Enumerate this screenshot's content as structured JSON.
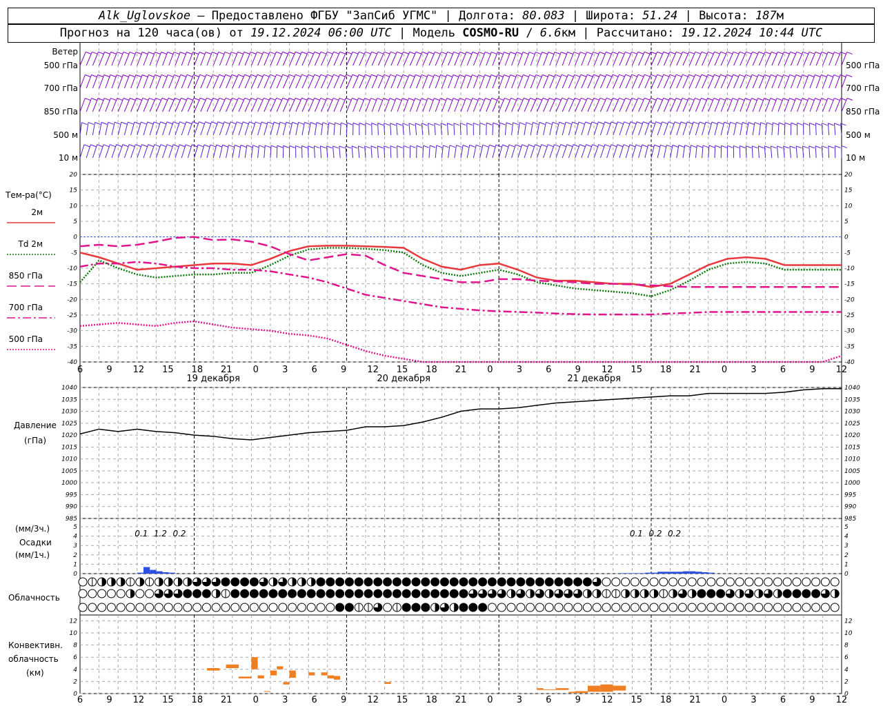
{
  "header": {
    "station": "Alk_Uglovskoe",
    "provider": "Предоставлено ФГБУ \"ЗапСиб УГМС\"",
    "lon_label": "Долгота:",
    "lon_value": "80.083",
    "lat_label": "Широта:",
    "lat_value": "51.24",
    "alt_label": "Высота:",
    "alt_value": "187",
    "alt_unit": "м",
    "forecast_prefix": "Прогноз на 120 часа(ов) от",
    "forecast_time": "19.12.2024 06:00 UTC",
    "model_label": "Модель",
    "model_name": "COSMO-RU",
    "model_res": "6.6",
    "model_res_unit": "км",
    "calc_label": "Рассчитано:",
    "calc_time": "19.12.2024 10:44 UTC"
  },
  "x_hour_labels": [
    "6",
    "9",
    "12",
    "15",
    "18",
    "21",
    "0",
    "3",
    "6",
    "9",
    "12",
    "15",
    "18",
    "21",
    "0",
    "3",
    "6",
    "9",
    "12",
    "15",
    "18",
    "21",
    "0",
    "3",
    "6",
    "9",
    "12"
  ],
  "day_labels": [
    "19 декабря",
    "20 декабря",
    "21 декабря"
  ],
  "wind_panel": {
    "title": "Ветер",
    "levels": [
      "500 гПа",
      "700 гПа",
      "850 гПа",
      "500 м",
      "10 м"
    ],
    "colors": {
      "upper": "#8000c0",
      "lower": "#5a1ed0"
    }
  },
  "temp_panel": {
    "title": "Тем-ра(°C)",
    "legend": [
      {
        "label": "2м",
        "color": "#e8383c",
        "style": "solid"
      },
      {
        "label": "Td  2м",
        "color": "#0a7a0a",
        "style": "dotted"
      },
      {
        "label": "850 гПа",
        "color": "#e0148c",
        "style": "dashed"
      },
      {
        "label": "700 гПа",
        "color": "#e0148c",
        "style": "dashdot"
      },
      {
        "label": "500 гПа",
        "color": "#e0148c",
        "style": "dotted"
      }
    ],
    "y_ticks": [
      "20",
      "15",
      "10",
      "5",
      "0",
      "-5",
      "-10",
      "-15",
      "-20",
      "-25",
      "-30",
      "-35",
      "-40"
    ]
  },
  "pressure_panel": {
    "title": "Давление",
    "unit": "(гПа)",
    "y_ticks": [
      "1040",
      "1035",
      "1030",
      "1025",
      "1020",
      "1015",
      "1010",
      "1005",
      "1000",
      "995",
      "990",
      "985"
    ]
  },
  "precip_panel": {
    "unit_3h": "(мм/3ч.)",
    "title": "Осадки",
    "unit_1h": "(мм/1ч.)",
    "y_ticks": [
      "5",
      "4",
      "3",
      "2",
      "1",
      "0"
    ],
    "totals": [
      {
        "value": "0.1",
        "at_hour": 9
      },
      {
        "value": "1.2",
        "at_hour": 12
      },
      {
        "value": "0.2",
        "at_hour": 15
      },
      {
        "value": "0.1",
        "at_hour": 87
      },
      {
        "value": "0.2",
        "at_hour": 90
      },
      {
        "value": "0.2",
        "at_hour": 93
      }
    ]
  },
  "cloud_panel": {
    "title": "Облачность"
  },
  "conv_panel": {
    "title_1": "Конвективн.",
    "title_2": "облачность",
    "unit": "(км)",
    "y_ticks": [
      "12",
      "10",
      "8",
      "6",
      "4",
      "2",
      "0"
    ]
  },
  "chart_data": [
    {
      "type": "line",
      "title": "Тем-ра(°C)",
      "x_unit": "hours since 19.12.2024 06:00 UTC",
      "x": [
        0,
        3,
        6,
        9,
        12,
        15,
        18,
        21,
        24,
        27,
        30,
        33,
        36,
        39,
        42,
        45,
        48,
        51,
        54,
        57,
        60,
        63,
        66,
        69,
        72,
        75,
        78,
        81,
        84,
        87,
        90,
        93,
        96,
        99,
        102,
        105,
        108,
        111,
        114,
        117,
        120
      ],
      "ylim": [
        -40,
        20
      ],
      "series": [
        {
          "name": "2м",
          "values": [
            -5,
            -6.5,
            -8.5,
            -10.5,
            -10,
            -9.5,
            -9,
            -8.5,
            -8.5,
            -9,
            -7,
            -4.5,
            -3,
            -2.8,
            -2.8,
            -3,
            -3.2,
            -3.5,
            -7,
            -9.5,
            -10.5,
            -9,
            -8.5,
            -10.5,
            -13,
            -14,
            -14,
            -14.5,
            -15,
            -15,
            -16,
            -15,
            -12,
            -9,
            -7,
            -6.5,
            -7,
            -9,
            -9,
            -9,
            -9
          ]
        },
        {
          "name": "Td  2м",
          "values": [
            -14.5,
            -7.5,
            -10,
            -12,
            -13,
            -12.5,
            -12,
            -12,
            -11.5,
            -11.5,
            -9,
            -6,
            -4,
            -3.5,
            -3.5,
            -3.8,
            -4.2,
            -5,
            -9,
            -11.5,
            -12.5,
            -11.5,
            -10.5,
            -12,
            -14.5,
            -15.5,
            -16.5,
            -17,
            -17.5,
            -18,
            -19,
            -17,
            -14,
            -10.5,
            -8.5,
            -8,
            -8.5,
            -10.5,
            -10.5,
            -10.5,
            -10.5
          ]
        },
        {
          "name": "850 гПа",
          "values": [
            -3,
            -2.5,
            -3,
            -2.5,
            -1.5,
            -0.3,
            0,
            -1,
            -0.8,
            -1.5,
            -3,
            -5.5,
            -7.5,
            -6.5,
            -5.5,
            -6,
            -9,
            -11.5,
            -12.5,
            -13.5,
            -14.5,
            -14.5,
            -13.5,
            -13.5,
            -14,
            -14.2,
            -14.5,
            -15,
            -15,
            -15.2,
            -15.5,
            -15.8,
            -16,
            -16,
            -16,
            -16,
            -16,
            -16,
            -16,
            -16,
            -16
          ]
        },
        {
          "name": "700 гПа",
          "values": [
            -9.5,
            -8.5,
            -8.5,
            -8,
            -8.5,
            -9.5,
            -10,
            -10,
            -10.5,
            -10.5,
            -11,
            -12,
            -13,
            -14.5,
            -16.5,
            -18.5,
            -19.5,
            -20.5,
            -21.5,
            -22.5,
            -23,
            -23.5,
            -23.8,
            -24,
            -24.2,
            -24.5,
            -24.7,
            -24.8,
            -24.8,
            -24.8,
            -24.8,
            -24.5,
            -24.3,
            -24,
            -24,
            -24,
            -24,
            -24,
            -24,
            -24,
            -24
          ]
        },
        {
          "name": "500 гПа",
          "values": [
            -28.5,
            -28,
            -27.5,
            -28,
            -28.5,
            -27.5,
            -27,
            -28,
            -29,
            -29.5,
            -30,
            -31,
            -31.5,
            -32.5,
            -34.5,
            -36.5,
            -38,
            -39,
            -40,
            -41,
            -42,
            -42,
            -42,
            -42,
            -42,
            -42,
            -42,
            -42,
            -42,
            -42,
            -42,
            -42,
            -42,
            -42,
            -42,
            -42,
            -42,
            -42,
            -42,
            -42,
            -38
          ]
        }
      ]
    },
    {
      "type": "line",
      "title": "Давление",
      "x": [
        0,
        3,
        6,
        9,
        12,
        15,
        18,
        21,
        24,
        27,
        30,
        33,
        36,
        39,
        42,
        45,
        48,
        51,
        54,
        57,
        60,
        63,
        66,
        69,
        72,
        75,
        78,
        81,
        84,
        87,
        90,
        93,
        96,
        99,
        102,
        105,
        108,
        111,
        114,
        117,
        120
      ],
      "ylim": [
        985,
        1040
      ],
      "series": [
        {
          "name": "",
          "values": [
            1020.5,
            1022.5,
            1021.5,
            1022.5,
            1021.5,
            1021,
            1020,
            1019.5,
            1018.5,
            1018,
            1019,
            1020,
            1021,
            1021.5,
            1022,
            1023.5,
            1023.5,
            1024,
            1025.5,
            1027.5,
            1030,
            1031,
            1031,
            1031.5,
            1032.5,
            1033.5,
            1034,
            1034.5,
            1035,
            1035.5,
            1036,
            1036.5,
            1036.5,
            1037.5,
            1037.5,
            1037.5,
            1037.5,
            1038,
            1039,
            1039.5,
            1039.5
          ]
        }
      ]
    },
    {
      "type": "bar",
      "title": "Осадки",
      "x": [
        9,
        10,
        11,
        12,
        13,
        14,
        85,
        86,
        87,
        88,
        89,
        90,
        91,
        92,
        93,
        94,
        95,
        96,
        97,
        98,
        99
      ],
      "values": [
        0.1,
        0.7,
        0.4,
        0.25,
        0.15,
        0.1,
        0.05,
        0.05,
        0.05,
        0.05,
        0.1,
        0.1,
        0.2,
        0.2,
        0.2,
        0.2,
        0.25,
        0.25,
        0.2,
        0.15,
        0.1
      ],
      "ylim": [
        0,
        5
      ]
    },
    {
      "type": "bar",
      "title": "Конвективн. облачность",
      "x_unit": "hours since 19.12.2024 06:00 UTC",
      "ylim": [
        0,
        12
      ],
      "bars": [
        {
          "x0": 20,
          "x1": 22,
          "bottom": 3.8,
          "top": 4.2
        },
        {
          "x0": 23,
          "x1": 25,
          "bottom": 4.2,
          "top": 4.8
        },
        {
          "x0": 25,
          "x1": 27,
          "bottom": 2.5,
          "top": 2.8
        },
        {
          "x0": 27,
          "x1": 28,
          "bottom": 4,
          "top": 6
        },
        {
          "x0": 28,
          "x1": 29,
          "bottom": 2.5,
          "top": 3
        },
        {
          "x0": 29,
          "x1": 30,
          "bottom": 0.3,
          "top": 0.4
        },
        {
          "x0": 30,
          "x1": 31,
          "bottom": 3,
          "top": 3.8
        },
        {
          "x0": 31,
          "x1": 32,
          "bottom": 4,
          "top": 4.5
        },
        {
          "x0": 32,
          "x1": 33,
          "bottom": 1.5,
          "top": 1.9
        },
        {
          "x0": 33,
          "x1": 34,
          "bottom": 2.6,
          "top": 3.8
        },
        {
          "x0": 36,
          "x1": 37,
          "bottom": 3,
          "top": 3.5
        },
        {
          "x0": 38,
          "x1": 39,
          "bottom": 3,
          "top": 3.5
        },
        {
          "x0": 39,
          "x1": 40,
          "bottom": 2.5,
          "top": 3
        },
        {
          "x0": 40,
          "x1": 41,
          "bottom": 2.3,
          "top": 2.9
        },
        {
          "x0": 48,
          "x1": 49,
          "bottom": 1.6,
          "top": 1.9
        },
        {
          "x0": 72,
          "x1": 73,
          "bottom": 0.6,
          "top": 0.9
        },
        {
          "x0": 73,
          "x1": 75,
          "bottom": 0.6,
          "top": 0.7
        },
        {
          "x0": 75,
          "x1": 77,
          "bottom": 0.6,
          "top": 0.9
        },
        {
          "x0": 77,
          "x1": 78,
          "bottom": 0.1,
          "top": 0.3
        },
        {
          "x0": 78,
          "x1": 80,
          "bottom": 0.1,
          "top": 0.4
        },
        {
          "x0": 80,
          "x1": 82,
          "bottom": 0.3,
          "top": 1.3
        },
        {
          "x0": 82,
          "x1": 84,
          "bottom": 0.3,
          "top": 1.5
        },
        {
          "x0": 84,
          "x1": 86,
          "bottom": 0.5,
          "top": 1.3
        }
      ],
      "color": "#f07f22"
    },
    {
      "type": "table",
      "title": "Облачность",
      "encoding": "each value = cloud cover in quarters (0 empty .. 4 full), 3 rows (high, middle, low), one symbol per hour 0..79",
      "rows": [
        [
          0,
          1,
          2,
          2,
          2,
          1,
          2,
          1,
          2,
          2,
          2,
          2,
          3,
          3,
          3,
          4,
          4,
          4,
          4,
          3,
          2,
          3,
          2,
          2,
          2,
          4,
          4,
          4,
          4,
          4,
          4,
          4,
          4,
          4,
          4,
          4,
          4,
          4,
          4,
          4,
          4,
          4,
          4,
          4,
          4,
          4,
          4,
          4,
          4,
          4,
          4,
          4,
          4,
          4,
          3,
          0,
          0,
          0,
          0,
          0,
          0,
          0,
          0,
          0,
          0,
          0,
          0,
          0,
          0,
          0,
          0,
          0,
          0,
          0,
          0,
          0,
          0,
          0,
          0,
          0
        ],
        [
          0,
          0,
          0,
          0,
          0,
          2,
          0,
          0,
          3,
          3,
          3,
          4,
          4,
          4,
          2,
          1,
          4,
          4,
          4,
          4,
          4,
          4,
          4,
          4,
          4,
          4,
          4,
          4,
          4,
          4,
          4,
          4,
          4,
          4,
          4,
          4,
          4,
          4,
          4,
          4,
          4,
          3,
          3,
          3,
          3,
          2,
          3,
          2,
          3,
          2,
          3,
          3,
          3,
          2,
          2,
          1,
          1,
          2,
          2,
          2,
          2,
          1,
          2,
          3,
          2,
          4,
          4,
          4,
          3,
          2,
          3,
          2,
          3,
          2,
          4,
          4,
          4,
          4,
          3,
          2
        ],
        [
          0,
          0,
          0,
          0,
          0,
          0,
          0,
          0,
          0,
          0,
          0,
          0,
          0,
          0,
          0,
          0,
          0,
          0,
          0,
          0,
          0,
          0,
          0,
          0,
          0,
          0,
          0,
          4,
          4,
          1,
          1,
          3,
          0,
          1,
          4,
          4,
          4,
          2,
          3,
          2,
          4,
          4,
          4,
          0,
          0,
          0,
          0,
          0,
          0,
          0,
          0,
          0,
          0,
          0,
          0,
          0,
          0,
          0,
          0,
          0,
          0,
          0,
          0,
          0,
          0,
          0,
          0,
          0,
          0,
          0,
          0,
          0,
          0,
          0,
          0,
          0,
          0,
          0,
          0,
          0
        ]
      ]
    }
  ]
}
